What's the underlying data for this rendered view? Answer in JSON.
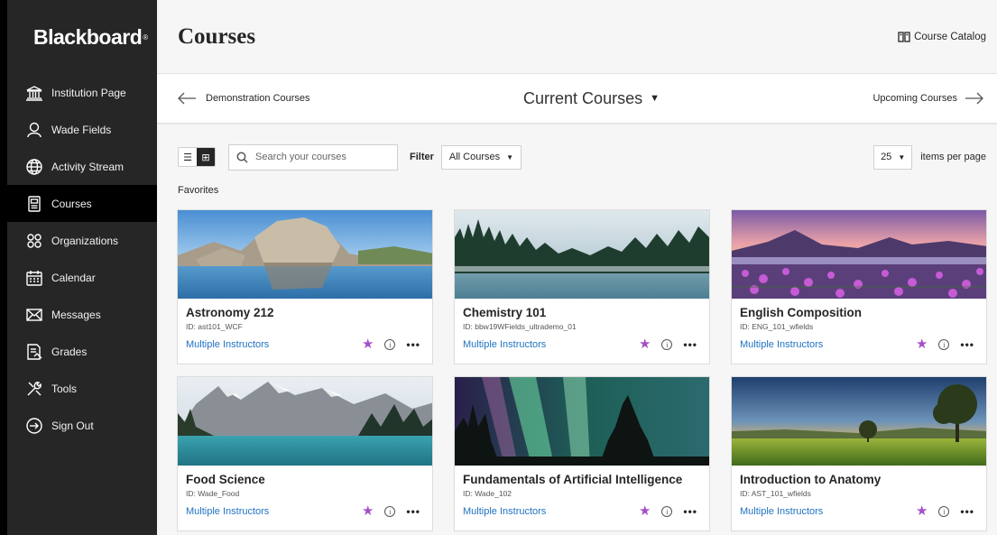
{
  "brand": {
    "name": "Blackboard"
  },
  "sidebar": {
    "items": [
      {
        "label": "Institution Page",
        "icon": "institution-icon"
      },
      {
        "label": "Wade Fields",
        "icon": "user-icon"
      },
      {
        "label": "Activity Stream",
        "icon": "globe-icon"
      },
      {
        "label": "Courses",
        "icon": "courses-icon",
        "active": true
      },
      {
        "label": "Organizations",
        "icon": "organizations-icon"
      },
      {
        "label": "Calendar",
        "icon": "calendar-icon"
      },
      {
        "label": "Messages",
        "icon": "envelope-icon"
      },
      {
        "label": "Grades",
        "icon": "grades-icon"
      },
      {
        "label": "Tools",
        "icon": "tools-icon"
      },
      {
        "label": "Sign Out",
        "icon": "sign-out-icon"
      }
    ]
  },
  "header": {
    "title": "Courses",
    "catalog_label": "Course Catalog"
  },
  "terms": {
    "previous": "Demonstration Courses",
    "current": "Current Courses",
    "next": "Upcoming Courses"
  },
  "toolbar": {
    "search_placeholder": "Search your courses",
    "filter_label": "Filter",
    "filter_value": "All Courses",
    "per_page_value": "25",
    "per_page_label": "items per page"
  },
  "section": {
    "label": "Favorites"
  },
  "courses": [
    {
      "title": "Astronomy 212",
      "id": "ID: ast101_WCF",
      "instructors": "Multiple Instructors"
    },
    {
      "title": "Chemistry 101",
      "id": "ID: bbw19WFields_ultrademo_01",
      "instructors": "Multiple Instructors"
    },
    {
      "title": "English Composition",
      "id": "ID: ENG_101_wfields",
      "instructors": "Multiple Instructors"
    },
    {
      "title": "Food Science",
      "id": "ID: Wade_Food",
      "instructors": "Multiple Instructors"
    },
    {
      "title": "Fundamentals of Artificial Intelligence",
      "id": "ID: Wade_102",
      "instructors": "Multiple Instructors"
    },
    {
      "title": "Introduction to Anatomy",
      "id": "ID: AST_101_wfields",
      "instructors": "Multiple Instructors"
    }
  ],
  "colors": {
    "sidebar": "#262626",
    "link": "#1f72c2",
    "favorite_star": "#a450c6"
  }
}
